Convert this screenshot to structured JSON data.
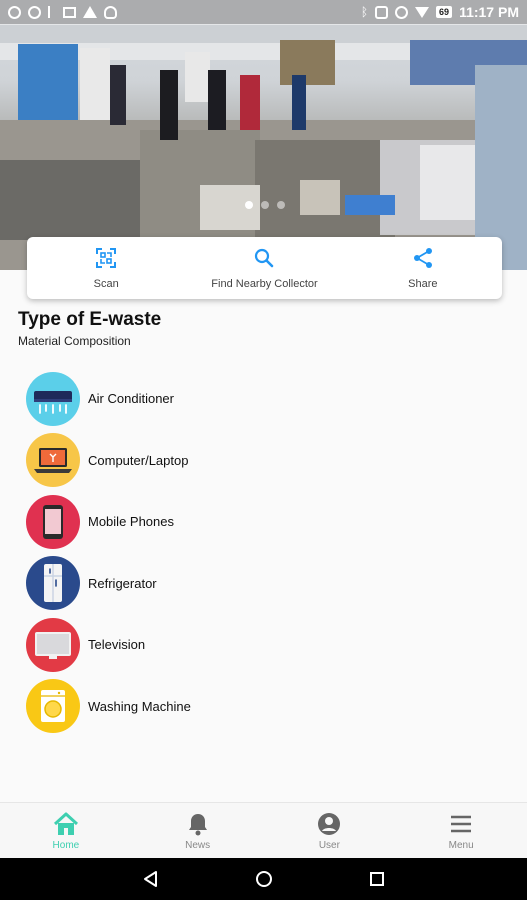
{
  "status_bar": {
    "time": "11:17 PM",
    "battery": "69"
  },
  "hero": {
    "dots": 3,
    "active_dot": 0
  },
  "actions": [
    {
      "id": "scan",
      "label": "Scan",
      "icon": "scan-icon"
    },
    {
      "id": "find",
      "label": "Find Nearby Collector",
      "icon": "search-icon"
    },
    {
      "id": "share",
      "label": "Share",
      "icon": "share-icon"
    }
  ],
  "section": {
    "title": "Type of E-waste",
    "subtitle": "Material Composition"
  },
  "items": [
    {
      "label": "Air Conditioner",
      "icon": "air-conditioner-icon",
      "color": "#5bcfe9"
    },
    {
      "label": "Computer/Laptop",
      "icon": "laptop-icon",
      "color": "#f7c648"
    },
    {
      "label": "Mobile Phones",
      "icon": "mobile-phone-icon",
      "color": "#e03150"
    },
    {
      "label": "Refrigerator",
      "icon": "refrigerator-icon",
      "color": "#2a4a8c"
    },
    {
      "label": "Television",
      "icon": "television-icon",
      "color": "#e23a45"
    },
    {
      "label": "Washing Machine",
      "icon": "washing-machine-icon",
      "color": "#f9c815"
    }
  ],
  "bottom_nav": [
    {
      "label": "Home",
      "icon": "home-icon",
      "active": true
    },
    {
      "label": "News",
      "icon": "bell-icon",
      "active": false
    },
    {
      "label": "User",
      "icon": "user-icon",
      "active": false
    },
    {
      "label": "Menu",
      "icon": "menu-icon",
      "active": false
    }
  ],
  "colors": {
    "accent": "#3ecfb0",
    "action_icon": "#2196f3",
    "nav_inactive": "#666666"
  }
}
